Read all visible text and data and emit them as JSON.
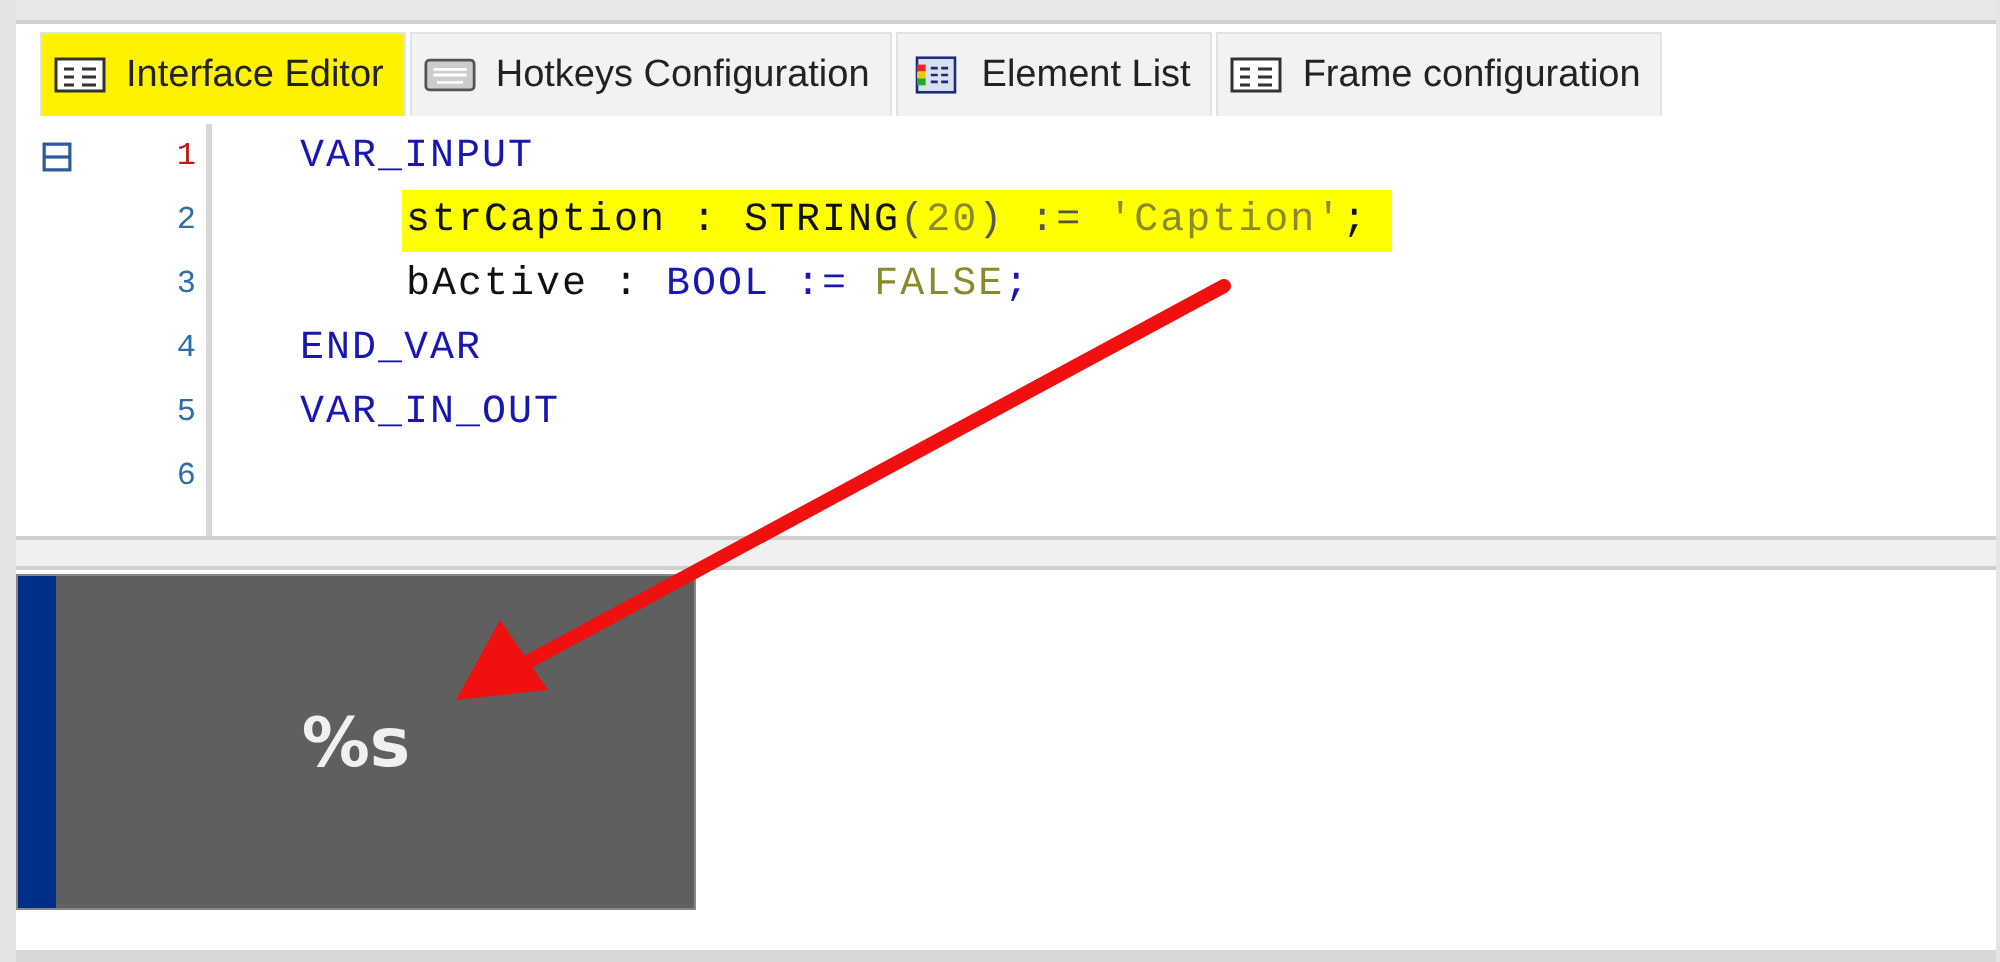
{
  "tabs": [
    {
      "label": "Interface Editor",
      "selected": true,
      "kind": "editor"
    },
    {
      "label": "Hotkeys Configuration",
      "selected": false,
      "kind": "keyboard"
    },
    {
      "label": "Element List",
      "selected": false,
      "kind": "list"
    },
    {
      "label": "Frame configuration",
      "selected": false,
      "kind": "editor"
    }
  ],
  "code": {
    "lines": [
      {
        "number": "1",
        "current": true,
        "foldable": true,
        "highlighted": false,
        "tokens": [
          {
            "text": "VAR_INPUT",
            "kind": "keyword"
          }
        ],
        "children": [
          {
            "number": "2",
            "current": false,
            "foldable": false,
            "highlighted": true,
            "tokens": [
              {
                "text": "strCaption : ",
                "kind": "plain"
              },
              {
                "text": "STRING",
                "kind": "plain"
              },
              {
                "text": "(",
                "kind": "punct"
              },
              {
                "text": "20",
                "kind": "literal"
              },
              {
                "text": ") := ",
                "kind": "punct"
              },
              {
                "text": "'Caption'",
                "kind": "literal"
              },
              {
                "text": ";",
                "kind": "plain"
              }
            ]
          },
          {
            "number": "3",
            "current": false,
            "foldable": false,
            "highlighted": false,
            "tokens": [
              {
                "text": "bActive : ",
                "kind": "plain"
              },
              {
                "text": "BOOL",
                "kind": "keyword"
              },
              {
                "text": " := ",
                "kind": "keyword"
              },
              {
                "text": "FALSE",
                "kind": "literal"
              },
              {
                "text": ";",
                "kind": "keyword"
              }
            ]
          }
        ]
      },
      {
        "number": "4",
        "current": false,
        "foldable": false,
        "highlighted": false,
        "tokens": [
          {
            "text": "END_VAR",
            "kind": "keyword"
          }
        ]
      },
      {
        "number": "5",
        "current": false,
        "foldable": false,
        "highlighted": false,
        "tokens": [
          {
            "text": "VAR_IN_OUT",
            "kind": "keyword"
          }
        ]
      },
      {
        "number": "6",
        "current": false,
        "foldable": false
      }
    ]
  },
  "preview": {
    "text": "%s"
  }
}
